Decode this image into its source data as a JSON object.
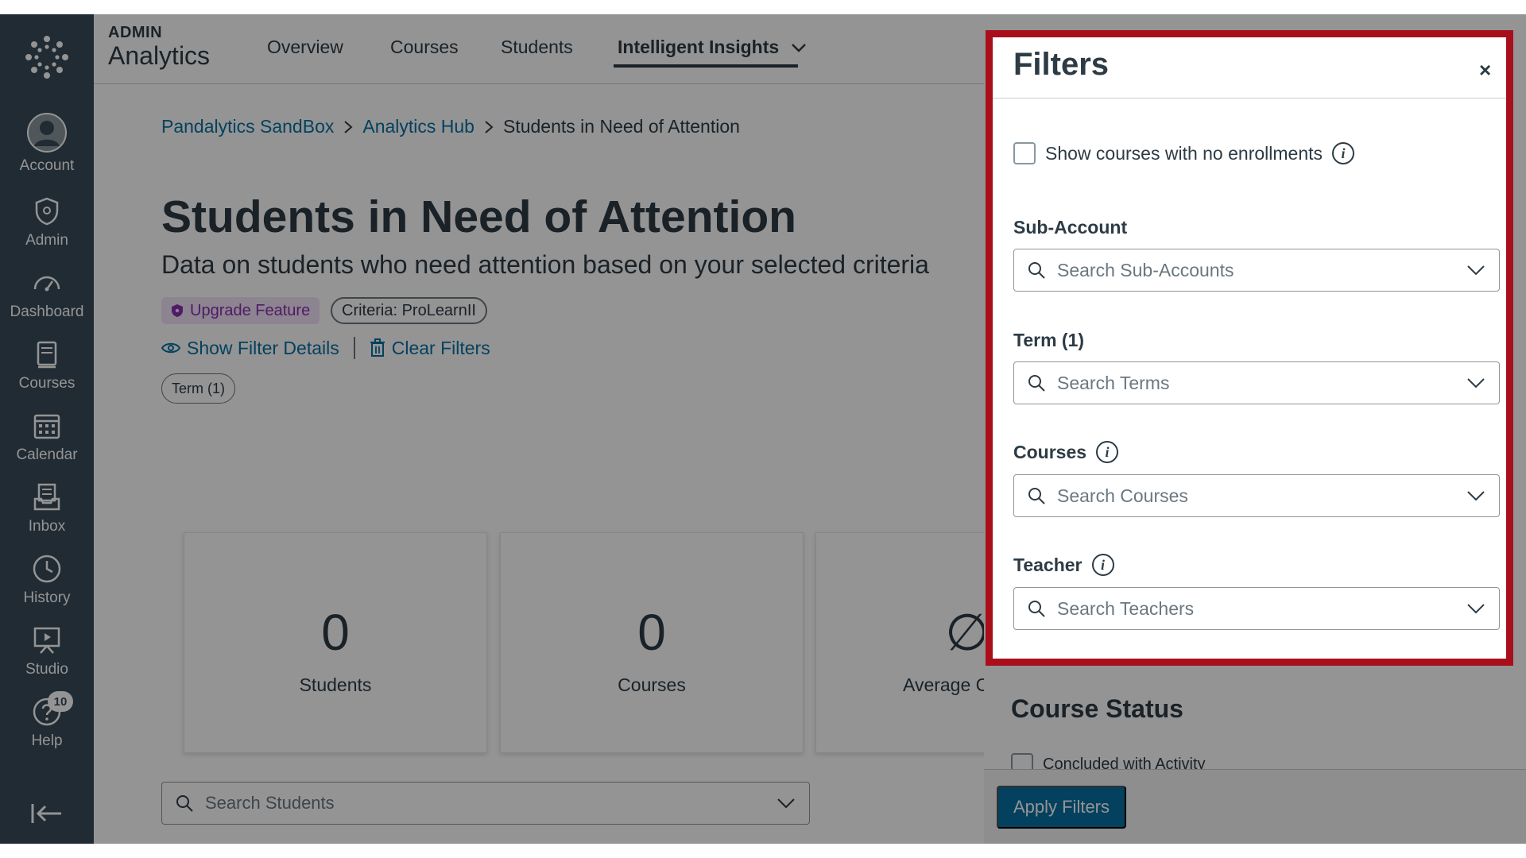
{
  "colors": {
    "nav_bg": "#394b58",
    "link": "#0770a3",
    "text": "#2d3b45",
    "highlight_border": "#a90f1a",
    "upgrade_bg": "#f1e4f8",
    "upgrade_text": "#8a2fb0",
    "overlay": "rgba(0,0,0,0.42)"
  },
  "global_nav": {
    "logo_icon": "canvas-logo-icon",
    "items": [
      {
        "label": "Account",
        "icon": "avatar-icon"
      },
      {
        "label": "Admin",
        "icon": "shield-icon"
      },
      {
        "label": "Dashboard",
        "icon": "speedometer-icon"
      },
      {
        "label": "Courses",
        "icon": "book-icon"
      },
      {
        "label": "Calendar",
        "icon": "calendar-icon"
      },
      {
        "label": "Inbox",
        "icon": "inbox-icon"
      },
      {
        "label": "History",
        "icon": "clock-icon"
      },
      {
        "label": "Studio",
        "icon": "studio-icon"
      },
      {
        "label": "Help",
        "icon": "help-icon",
        "badge": "10"
      }
    ],
    "collapse_icon": "collapse-arrow-icon"
  },
  "header": {
    "brand_small": "ADMIN",
    "brand_big": "Analytics",
    "tabs": [
      {
        "label": "Overview"
      },
      {
        "label": "Courses"
      },
      {
        "label": "Students"
      },
      {
        "label": "Intelligent Insights",
        "active": true
      }
    ]
  },
  "breadcrumb": {
    "items": [
      "Pandalytics SandBox",
      "Analytics Hub"
    ],
    "current": "Students in Need of Attention"
  },
  "page": {
    "title": "Students in Need of Attention",
    "subtitle": "Data on students who need attention based on your selected criteria",
    "upgrade_label": "Upgrade Feature",
    "criteria_label": "Criteria: ProLearnII",
    "show_filter_details": "Show Filter Details",
    "clear_filters": "Clear Filters",
    "term_pill": "Term (1)"
  },
  "stats": [
    {
      "value": "0",
      "label": "Students"
    },
    {
      "value": "0",
      "label": "Courses"
    },
    {
      "value": "∅",
      "label": "Average Curren"
    }
  ],
  "search_students": {
    "placeholder": "Search Students"
  },
  "tray": {
    "course_status_heading": "Course Status",
    "concluded_label": "Concluded with Activity",
    "apply_button": "Apply Filters"
  },
  "filters_panel": {
    "title": "Filters",
    "close": "×",
    "no_enrollments_label": "Show courses with no enrollments",
    "sub_account_label": "Sub-Account",
    "sub_account_placeholder": "Search Sub-Accounts",
    "term_label": "Term (1)",
    "term_placeholder": "Search Terms",
    "courses_label": "Courses",
    "courses_placeholder": "Search Courses",
    "teacher_label": "Teacher",
    "teacher_placeholder": "Search Teachers"
  }
}
